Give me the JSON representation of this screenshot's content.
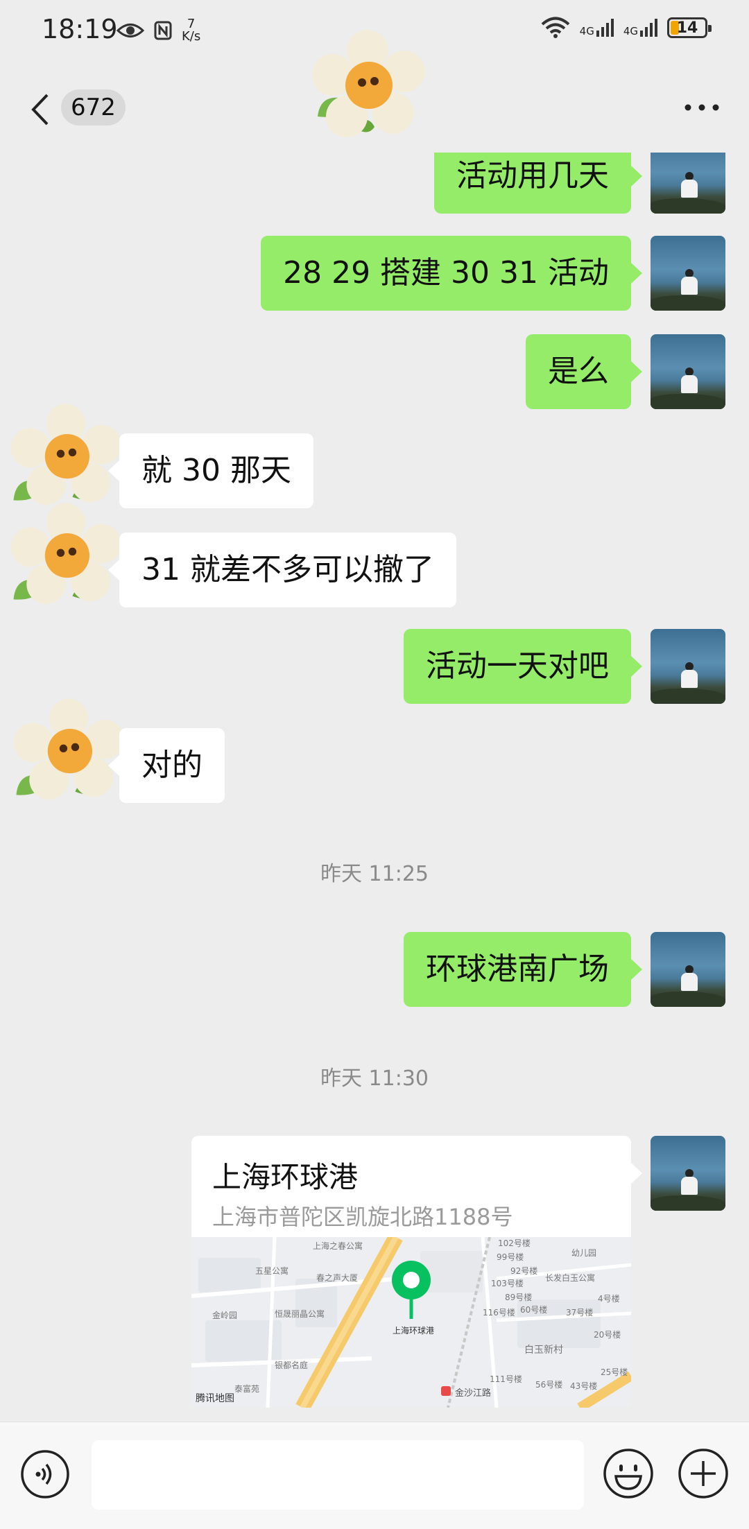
{
  "status_bar": {
    "time": "18:19",
    "net_speed_value": "7",
    "net_speed_unit": "K/s",
    "signal1": "4G",
    "signal2": "4G",
    "battery": "14",
    "icons": [
      "eye-icon",
      "nfc-icon",
      "wifi-icon",
      "signal-icon",
      "battery-icon"
    ]
  },
  "nav": {
    "unread_count": "672",
    "icons": [
      "back-icon",
      "more-icon"
    ]
  },
  "messages": [
    {
      "side": "out",
      "text": "活动用几天"
    },
    {
      "side": "out",
      "text": "28 29 搭建  30 31 活动"
    },
    {
      "side": "out",
      "text": "是么"
    },
    {
      "side": "in",
      "text": "就 30 那天"
    },
    {
      "side": "in",
      "text": "31 就差不多可以撤了"
    },
    {
      "side": "out",
      "text": "活动一天对吧"
    },
    {
      "side": "in",
      "text": "对的"
    },
    {
      "type": "time",
      "text": "昨天 11:25"
    },
    {
      "side": "out",
      "text": "环球港南广场"
    },
    {
      "type": "time",
      "text": "昨天 11:30"
    }
  ],
  "location": {
    "name": "上海环球港",
    "address": "上海市普陀区凯旋北路1188号",
    "map_brand": "腾讯地图",
    "map_pin_label": "上海环球港",
    "map_labels": [
      "上海之春公寓",
      "春之声大厦",
      "五星公寓",
      "恒晟丽晶公寓",
      "金岭园",
      "银都名庭",
      "泰富苑",
      "长发白玉公寓",
      "白玉新村",
      "金沙江路",
      "幼儿园",
      "102号楼",
      "99号楼",
      "92号楼",
      "103号楼",
      "89号楼",
      "116号楼",
      "60号楼",
      "37号楼",
      "20号楼",
      "111号楼",
      "56号楼",
      "43号楼",
      "25号楼",
      "4号楼"
    ]
  },
  "colors": {
    "out_bubble": "#95ec69",
    "in_bubble": "#ffffff",
    "background": "#ededed",
    "map_pin": "#07c160",
    "road": "#f6c96a"
  }
}
